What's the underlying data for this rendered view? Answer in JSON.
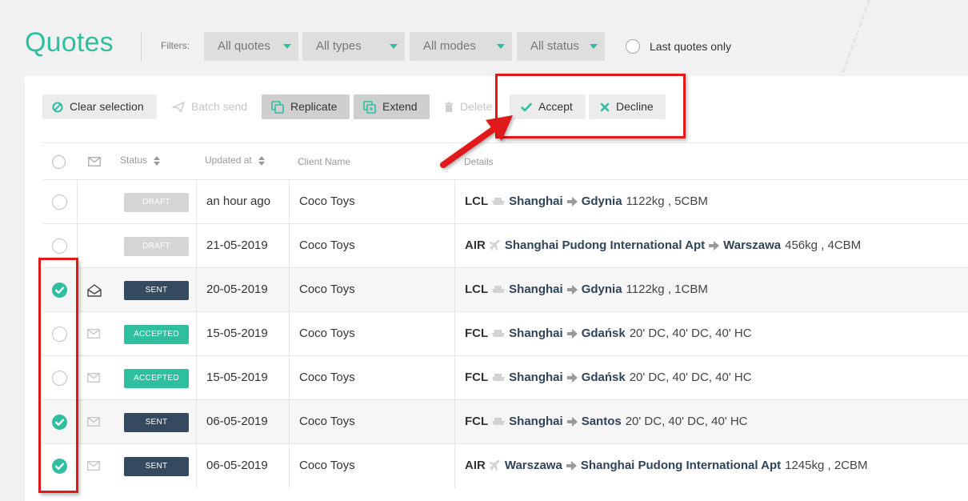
{
  "header": {
    "title": "Quotes",
    "filters_label": "Filters:",
    "filters": [
      "All quotes",
      "All types",
      "All modes",
      "All status"
    ],
    "last_quotes_label": "Last quotes only"
  },
  "toolbar": {
    "clear_selection": "Clear selection",
    "batch_send": "Batch send",
    "replicate": "Replicate",
    "extend": "Extend",
    "delete": "Delete",
    "accept": "Accept",
    "decline": "Decline"
  },
  "table": {
    "headers": {
      "status": "Status",
      "updated_at": "Updated at",
      "client_name": "Client Name",
      "details": "Details"
    },
    "rows": [
      {
        "checked": false,
        "mail": "none",
        "status": "DRAFT",
        "updated": "an hour ago",
        "client": "Coco Toys",
        "mode": "LCL",
        "mode_icon": "ship-icon",
        "from": "Shanghai",
        "to": "Gdynia",
        "extra": "1122kg , 5CBM"
      },
      {
        "checked": false,
        "mail": "none",
        "status": "DRAFT",
        "updated": "21-05-2019",
        "client": "Coco Toys",
        "mode": "AIR",
        "mode_icon": "plane-icon",
        "from": "Shanghai Pudong International Apt",
        "to": "Warszawa",
        "extra": "456kg , 4CBM"
      },
      {
        "checked": true,
        "mail": "opened",
        "status": "SENT",
        "updated": "20-05-2019",
        "client": "Coco Toys",
        "mode": "LCL",
        "mode_icon": "ship-icon",
        "from": "Shanghai",
        "to": "Gdynia",
        "extra": "1122kg , 1CBM"
      },
      {
        "checked": false,
        "mail": "closed",
        "status": "ACCEPTED",
        "updated": "15-05-2019",
        "client": "Coco Toys",
        "mode": "FCL",
        "mode_icon": "ship-icon",
        "from": "Shanghai",
        "to": "Gdańsk",
        "extra": "20' DC, 40' DC, 40' HC"
      },
      {
        "checked": false,
        "mail": "closed",
        "status": "ACCEPTED",
        "updated": "15-05-2019",
        "client": "Coco Toys",
        "mode": "FCL",
        "mode_icon": "ship-icon",
        "from": "Shanghai",
        "to": "Gdańsk",
        "extra": "20' DC, 40' DC, 40' HC"
      },
      {
        "checked": true,
        "mail": "closed",
        "status": "SENT",
        "updated": "06-05-2019",
        "client": "Coco Toys",
        "mode": "FCL",
        "mode_icon": "ship-icon",
        "from": "Shanghai",
        "to": "Santos",
        "extra": "20' DC, 40' DC, 40' HC"
      },
      {
        "checked": true,
        "mail": "closed",
        "status": "SENT",
        "updated": "06-05-2019",
        "client": "Coco Toys",
        "mode": "AIR",
        "mode_icon": "plane-icon",
        "from": "Warszawa",
        "to": "Shanghai Pudong International Apt",
        "extra": "1245kg , 2CBM"
      }
    ]
  },
  "colors": {
    "accent": "#2fbf9f",
    "sent": "#354a5f",
    "draft": "#d5d5d5",
    "annotation": "#e0191b"
  }
}
